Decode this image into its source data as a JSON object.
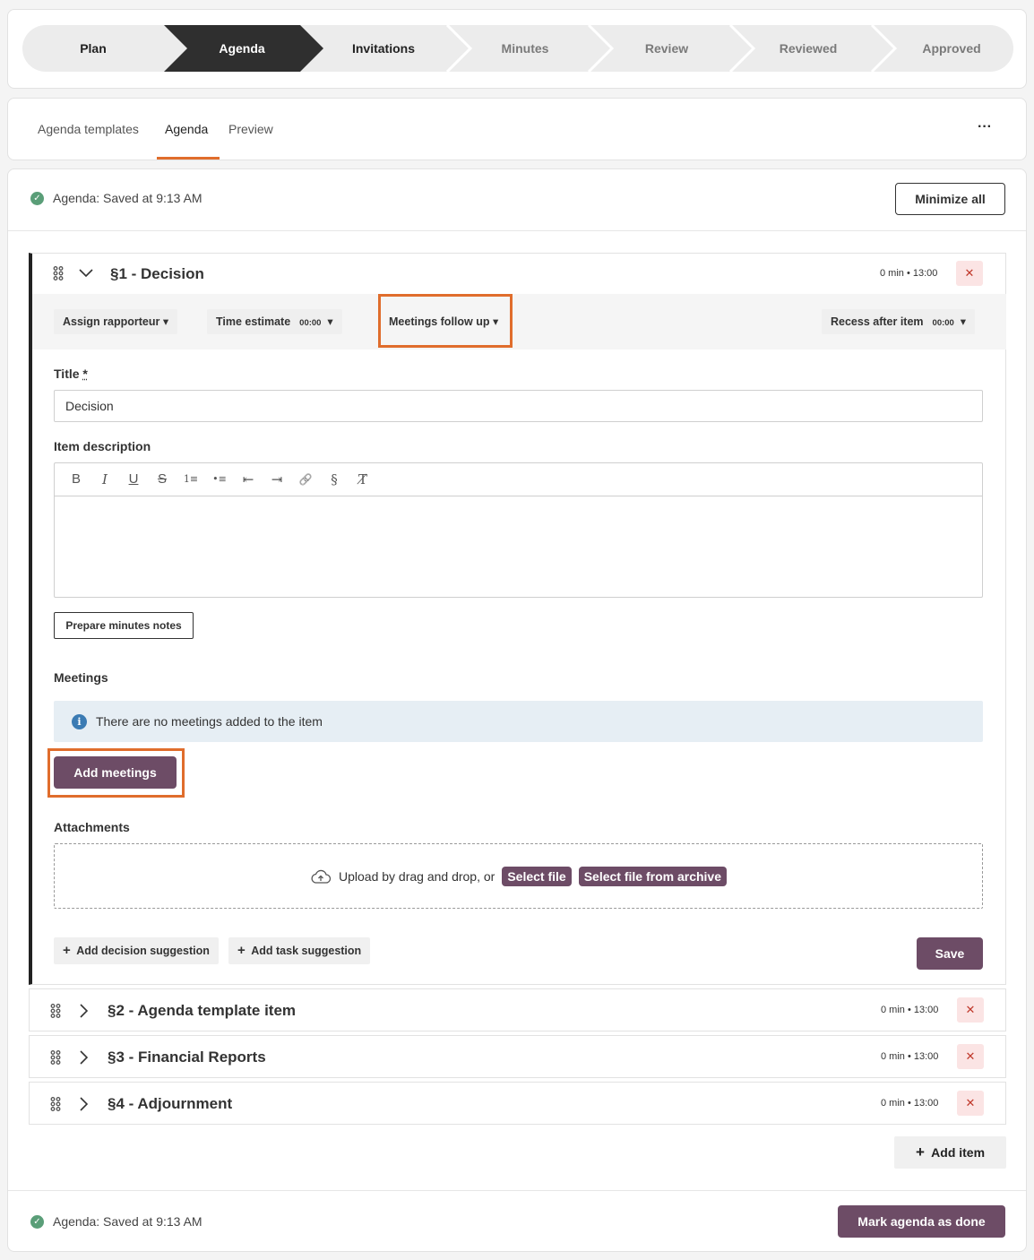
{
  "stepper": {
    "steps": [
      {
        "label": "Plan",
        "state": "done"
      },
      {
        "label": "Agenda",
        "state": "active"
      },
      {
        "label": "Invitations",
        "state": "next"
      },
      {
        "label": "Minutes",
        "state": "pending"
      },
      {
        "label": "Review",
        "state": "pending"
      },
      {
        "label": "Reviewed",
        "state": "pending"
      },
      {
        "label": "Approved",
        "state": "pending"
      }
    ],
    "colors": {
      "active": "#2f2f2f",
      "inactive": "#ececec",
      "active_text": "#ffffff",
      "next_text": "#222222",
      "pending_text": "#7a7a7a"
    }
  },
  "tabs": {
    "items": [
      "Agenda templates",
      "Agenda",
      "Preview"
    ],
    "active": "Agenda",
    "more_label": "···"
  },
  "status": {
    "top_text": "Agenda: Saved at 9:13 AM",
    "bottom_text": "Agenda: Saved at 9:13 AM",
    "minimize_label": "Minimize all"
  },
  "item1": {
    "title": "§1 - Decision",
    "meta": "0 min • 13:00",
    "delete_label": "✕",
    "toolbar": {
      "assign_label": "Assign rapporteur",
      "time_label": "Time estimate",
      "time_value": "00:00",
      "meetings_followup_label": "Meetings follow up",
      "recess_label": "Recess after item",
      "recess_value": "00:00"
    },
    "title_label": "Title",
    "title_required": "*",
    "title_value": "Decision",
    "description_label": "Item description",
    "editor_buttons": [
      "B",
      "I",
      "U",
      "S",
      "1≡",
      "•≡",
      "⇤",
      "⇥",
      "🔗",
      "§",
      "T̸"
    ],
    "prepare_label": "Prepare minutes notes",
    "meetings_label": "Meetings",
    "meetings_empty": "There are no meetings added to the item",
    "info_icon": "i",
    "add_meetings_label": "Add meetings",
    "attachments_label": "Attachments",
    "upload_text": "Upload by drag and drop, or",
    "select_file_label": "Select file",
    "select_archive_label": "Select file from archive",
    "add_decision_label": "Add decision suggestion",
    "add_task_label": "Add task suggestion",
    "save_label": "Save"
  },
  "items": [
    {
      "title": "§2 - Agenda template item",
      "meta": "0 min • 13:00"
    },
    {
      "title": "§3 - Financial Reports",
      "meta": "0 min • 13:00"
    },
    {
      "title": "§4 - Adjournment",
      "meta": "0 min • 13:00"
    }
  ],
  "add_item_label": "Add item",
  "mark_done_label": "Mark agenda as done",
  "colors": {
    "accent": "#6d4c66",
    "highlight": "#e06d2c",
    "success": "#5a9e78"
  }
}
